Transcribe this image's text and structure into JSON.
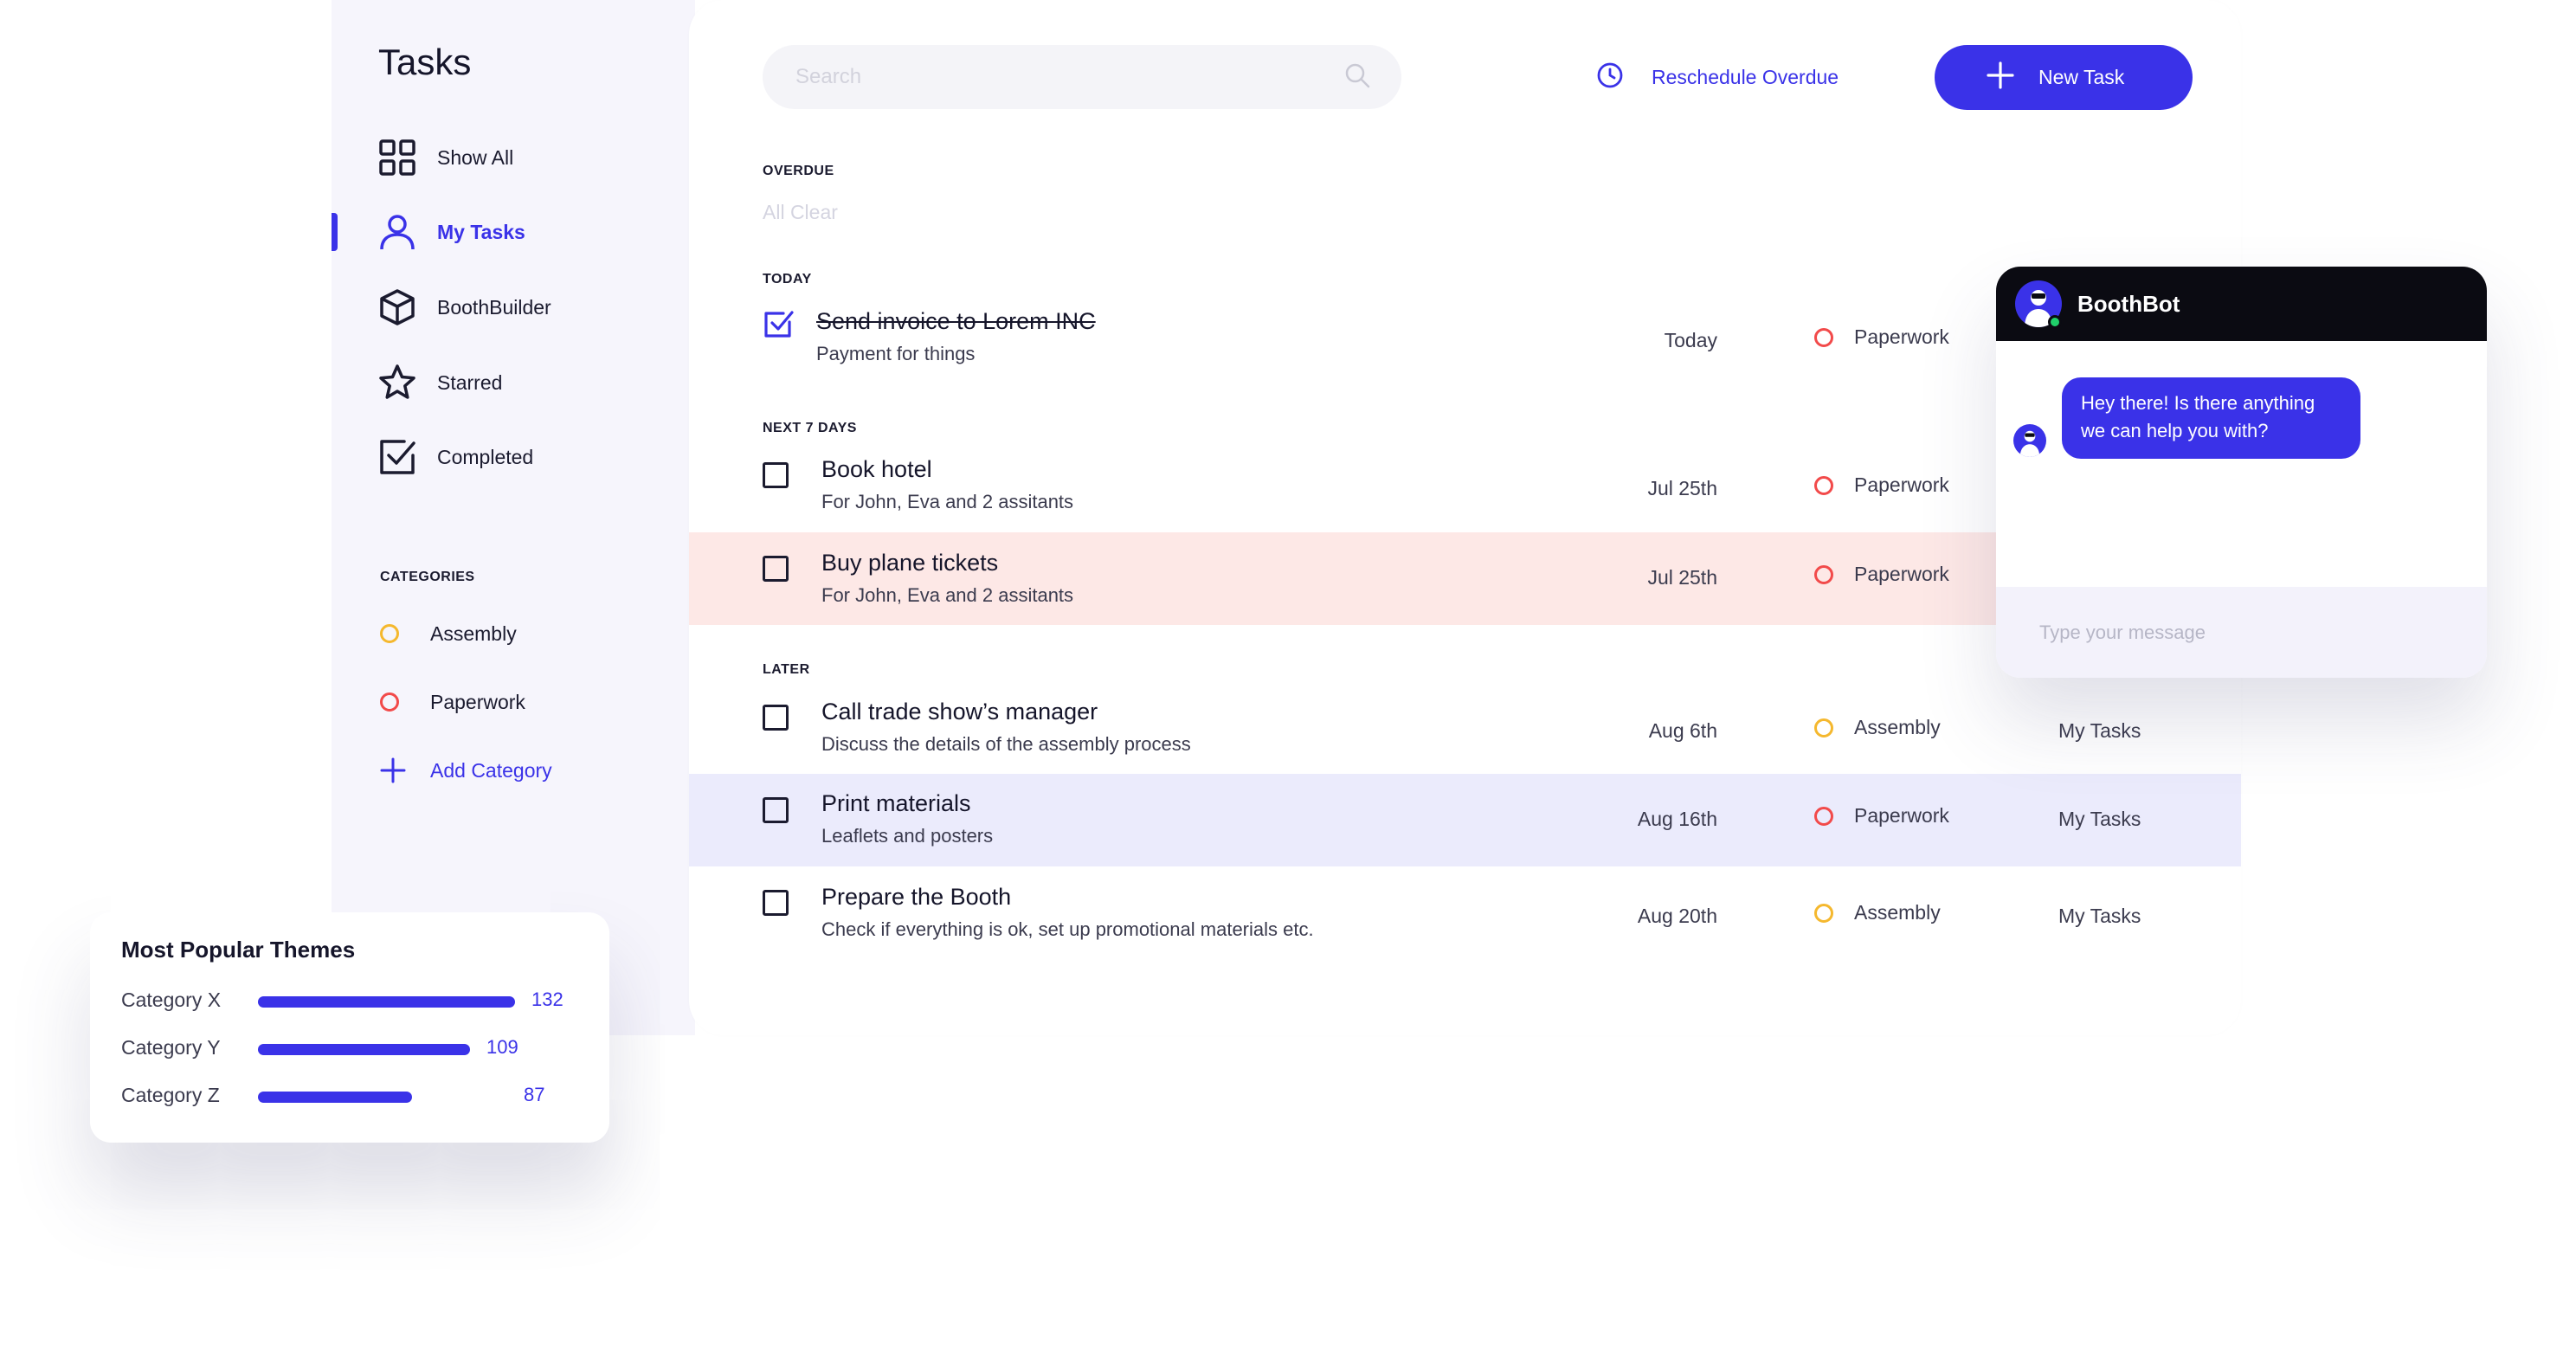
{
  "sidebar": {
    "title": "Tasks",
    "nav": [
      {
        "label": "Show All",
        "icon": "grid-icon"
      },
      {
        "label": "My Tasks",
        "icon": "user-icon",
        "active": true
      },
      {
        "label": "BoothBuilder",
        "icon": "box-icon"
      },
      {
        "label": "Starred",
        "icon": "star-icon"
      },
      {
        "label": "Completed",
        "icon": "checkbox-icon"
      }
    ],
    "categories_heading": "CATEGORIES",
    "categories": [
      {
        "label": "Assembly",
        "color": "#f5b82e"
      },
      {
        "label": "Paperwork",
        "color": "#f24a4a"
      }
    ],
    "add_category": "Add Category"
  },
  "toolbar": {
    "search_placeholder": "Search",
    "reschedule": "Reschedule Overdue",
    "new_task": "New Task"
  },
  "sections": {
    "overdue": "OVERDUE",
    "overdue_empty": "All Clear",
    "today": "TODAY",
    "next7": "NEXT 7 DAYS",
    "later": "LATER"
  },
  "tasks": {
    "today": [
      {
        "title": "Send invoice to Lorem INC",
        "subtitle": "Payment for things",
        "date": "Today",
        "category": "Paperwork",
        "done": true
      }
    ],
    "next7": [
      {
        "title": "Book hotel",
        "subtitle": "For John, Eva and 2 assitants",
        "date": "Jul 25th",
        "category": "Paperwork"
      },
      {
        "title": "Buy plane tickets",
        "subtitle": "For John, Eva and 2 assitants",
        "date": "Jul 25th",
        "category": "Paperwork"
      }
    ],
    "later": [
      {
        "title": "Call trade show’s manager",
        "subtitle": "Discuss the details of the assembly process",
        "date": "Aug 6th",
        "category": "Assembly",
        "list": "My Tasks"
      },
      {
        "title": "Print materials",
        "subtitle": "Leaflets and posters",
        "date": "Aug 16th",
        "category": "Paperwork",
        "list": "My Tasks"
      },
      {
        "title": "Prepare the Booth",
        "subtitle": "Check if everything is ok, set up promotional materials etc.",
        "date": "Aug 20th",
        "category": "Assembly",
        "list": "My Tasks"
      }
    ]
  },
  "chatbot": {
    "name": "BoothBot",
    "message": "Hey there! Is there anything we can help you with?",
    "input_placeholder": "Type your message"
  },
  "themes": {
    "title": "Most Popular Themes",
    "items": [
      {
        "label": "Category X",
        "value": "132"
      },
      {
        "label": "Category Y",
        "value": "109"
      },
      {
        "label": "Category Z",
        "value": "87"
      }
    ]
  },
  "colors": {
    "accent": "#3a32e8",
    "assembly": "#f5b82e",
    "paperwork": "#f24a4a",
    "highlight_pink": "#fde8e6",
    "highlight_lavender": "#ebebfc"
  }
}
